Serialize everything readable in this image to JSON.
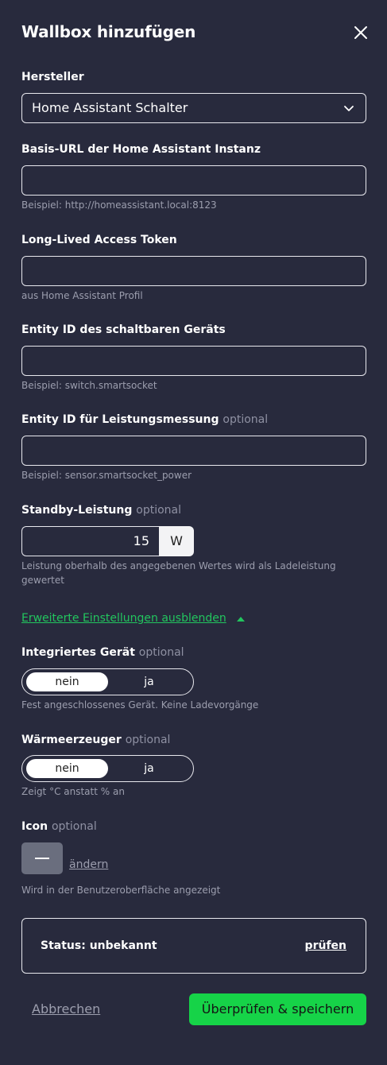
{
  "dialog": {
    "title": "Wallbox hinzufügen",
    "close_icon": "close-icon"
  },
  "manufacturer": {
    "label": "Hersteller",
    "value": "Home Assistant Schalter"
  },
  "base_url": {
    "label": "Basis-URL der Home Assistant Instanz",
    "value": "",
    "help": "Beispiel: http://homeassistant.local:8123"
  },
  "token": {
    "label": "Long-Lived Access Token",
    "value": "",
    "help": "aus Home Assistant Profil"
  },
  "switch_entity": {
    "label": "Entity ID des schaltbaren Geräts",
    "value": "",
    "help": "Beispiel: switch.smartsocket"
  },
  "power_entity": {
    "label": "Entity ID für Leistungsmessung",
    "optional": "optional",
    "value": "",
    "help": "Beispiel: sensor.smartsocket_power"
  },
  "standby": {
    "label": "Standby-Leistung",
    "optional": "optional",
    "value": "15",
    "unit": "W",
    "help_line1": "Leistung oberhalb des angegebenen Wertes wird als Ladeleistung",
    "help_line2": "gewertet"
  },
  "advanced_toggle": "Erweiterte Einstellungen ausblenden",
  "integrated": {
    "label": "Integriertes Gerät",
    "optional": "optional",
    "option_no": "nein",
    "option_yes": "ja",
    "selected": "nein",
    "help": "Fest angeschlossenes Gerät. Keine Ladevorgänge"
  },
  "heater": {
    "label": "Wärmeerzeuger",
    "optional": "optional",
    "option_no": "nein",
    "option_yes": "ja",
    "selected": "nein",
    "help": "Zeigt °C anstatt % an"
  },
  "icon": {
    "label": "Icon",
    "optional": "optional",
    "change": "ändern",
    "help": "Wird in der Benutzeroberfläche angezeigt"
  },
  "status": {
    "text": "Status: unbekannt",
    "check": "prüfen"
  },
  "footer": {
    "cancel": "Abbrechen",
    "save": "Überprüfen & speichern"
  },
  "colors": {
    "background": "#282a3d",
    "accent_green": "#16d348",
    "link_green": "#22c55e"
  }
}
